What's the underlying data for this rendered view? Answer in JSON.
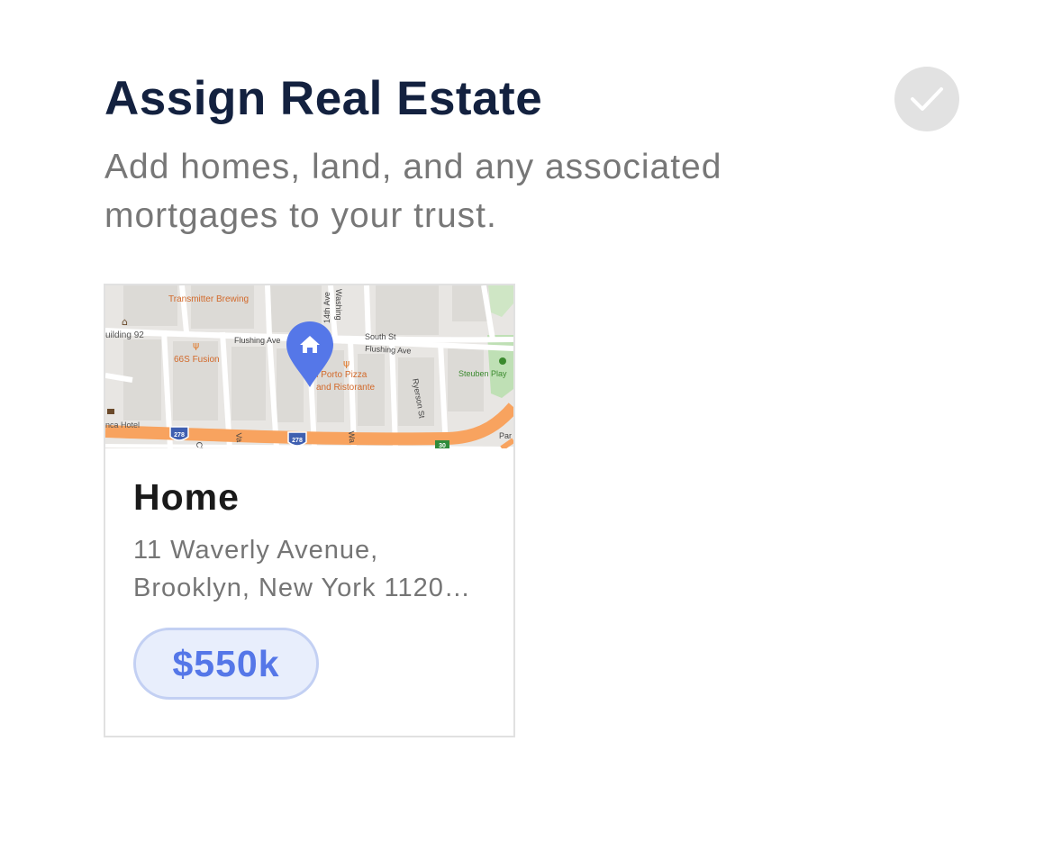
{
  "section": {
    "title": "Assign Real Estate",
    "subtitle": "Add homes, land, and any associated mortgages to your trust.",
    "check_icon": "checkmark-icon",
    "check_color": "#e2e2e2"
  },
  "property_card": {
    "title": "Home",
    "address_line1": "11 Waverly Avenue,",
    "address_line2": "Brooklyn, New York 1120…",
    "value": "$550k",
    "pin_icon": "home-pin-icon",
    "accent_color": "#5577e8",
    "map": {
      "labels": {
        "transmitter": "Transmitter Brewing",
        "building": "uilding 92",
        "fusion": "66S Fusion",
        "flushing1": "Flushing Ave",
        "flushing2": "Flushing Ave",
        "south": "South St",
        "washing": "Washing",
        "ave14": "14th Ave",
        "porto1": "ll Porto Pizza",
        "porto2": "and Ristorante",
        "ryerson": "Ryerson St",
        "steuben": "Steuben Play",
        "hotel": "nca Hotel",
        "shield1": "278",
        "shield2": "278",
        "shield3": "30",
        "par": "Par",
        "cl": "Cl",
        "va": "Va",
        "wa": "Wa"
      }
    }
  }
}
